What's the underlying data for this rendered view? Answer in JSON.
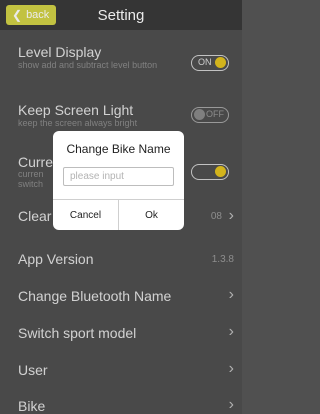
{
  "header": {
    "back_label": "back",
    "title": "Setting"
  },
  "settings": {
    "level_display": {
      "label": "Level Display",
      "sub": "show add and subtract level button",
      "toggle": "ON"
    },
    "keep_screen_light": {
      "label": "Keep Screen Light",
      "sub": "keep the screen always bright",
      "toggle": "OFF"
    },
    "current_row": {
      "label": "Curre",
      "sub_line1": "curren",
      "sub_line2": "switch"
    },
    "clear_row": {
      "label": "Clear",
      "value": "08"
    },
    "app_version": {
      "label": "App Version",
      "value": "1.3.8"
    },
    "change_bluetooth": {
      "label": "Change Bluetooth Name"
    },
    "switch_sport": {
      "label": "Switch sport model"
    },
    "user": {
      "label": "User"
    },
    "bike": {
      "label": "Bike"
    }
  },
  "dialog": {
    "title": "Change Bike Name",
    "input_placeholder": "please input",
    "input_value": "",
    "cancel_label": "Cancel",
    "ok_label": "Ok"
  },
  "colors": {
    "accent": "#e5c41f",
    "back_button": "#d3d347",
    "background": "#505050"
  }
}
